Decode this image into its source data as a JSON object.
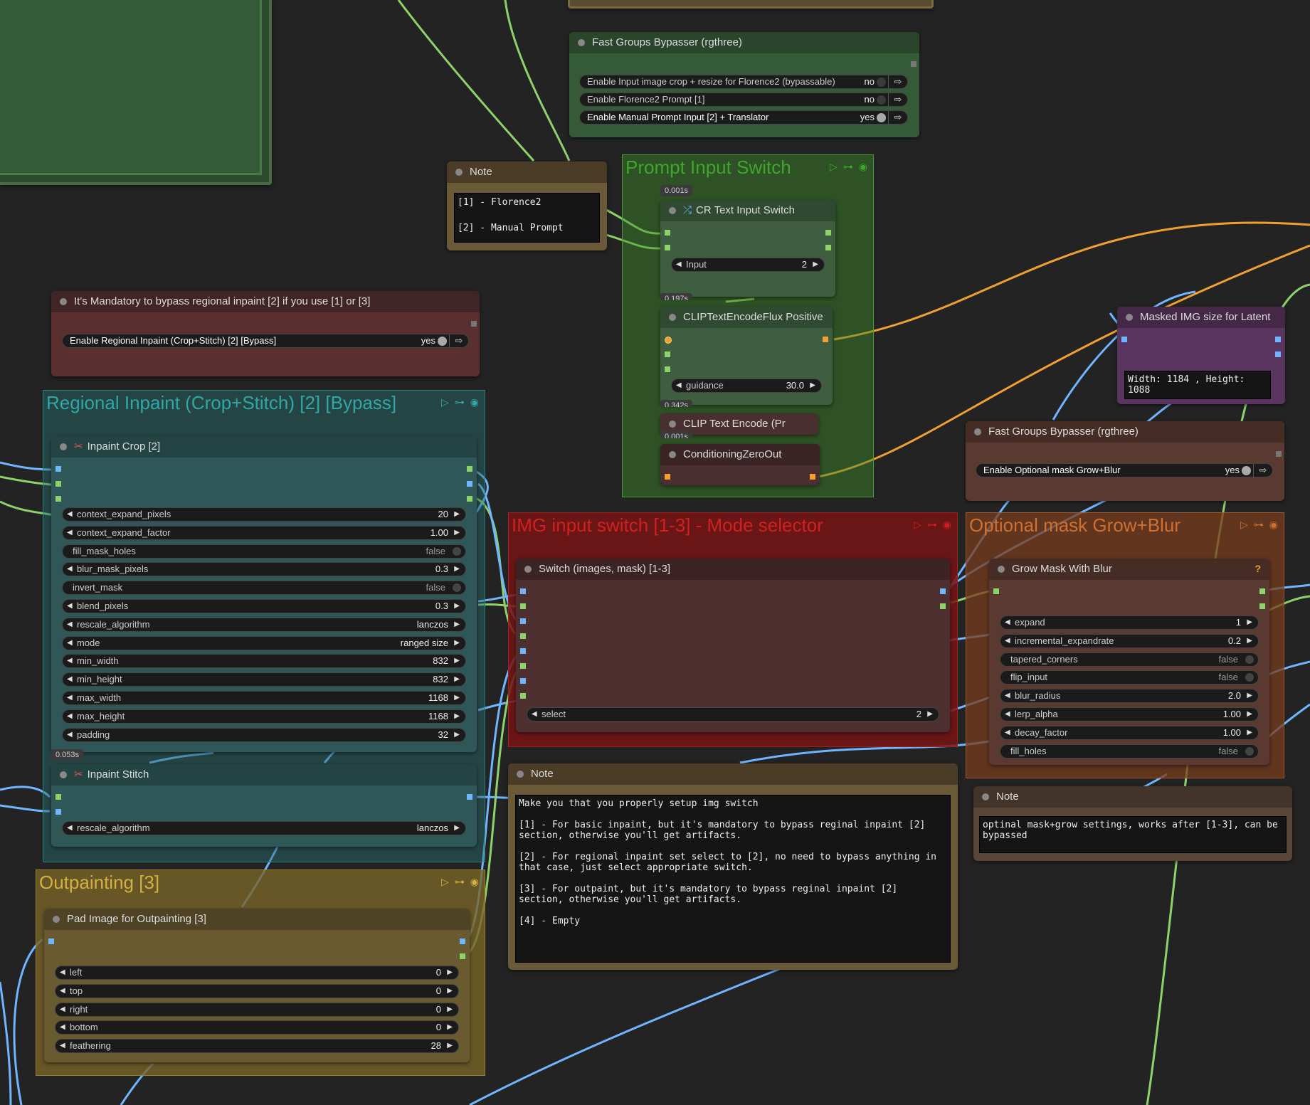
{
  "fgb_top": {
    "title": "Fast Groups Bypasser (rgthree)",
    "rows": [
      {
        "label": "Enable Input image crop + resize for Florence2 (bypassable)",
        "value": "no"
      },
      {
        "label": "Enable Florence2 Prompt [1]",
        "value": "no"
      },
      {
        "label": "Enable Manual Prompt Input [2] + Translator",
        "value": "yes"
      }
    ]
  },
  "note_top": {
    "title": "Note",
    "text": "[1] - Florence2\n\n[2] - Manual Prompt"
  },
  "prompt_group": {
    "title": "Prompt Input Switch"
  },
  "cr_switch": {
    "title": "CR Text Input Switch",
    "timer": "0.001s",
    "widget_label": "Input",
    "widget_value": "2"
  },
  "clip_flux": {
    "title": "CLIPTextEncodeFlux Positive",
    "timer": "0.197s",
    "widget_label": "guidance",
    "widget_value": "30.0"
  },
  "clip_text": {
    "title": "CLIP Text Encode (Pr",
    "timer": "0.342s"
  },
  "cond_zero": {
    "title": "ConditioningZeroOut",
    "timer": "0.001s"
  },
  "fgb_mandatory": {
    "title": "It's Mandatory to bypass regional inpaint [2] if you use [1] or [3]",
    "rows": [
      {
        "label": "Enable Regional Inpaint (Crop+Stitch) [2] [Bypass]",
        "value": "yes"
      }
    ]
  },
  "regional_group": {
    "title": "Regional Inpaint (Crop+Stitch) [2] [Bypass]"
  },
  "inpaint_crop": {
    "title": "Inpaint Crop [2]",
    "widgets": [
      {
        "label": "context_expand_pixels",
        "value": "20",
        "kind": "num"
      },
      {
        "label": "context_expand_factor",
        "value": "1.00",
        "kind": "num"
      },
      {
        "label": "fill_mask_holes",
        "value": "false",
        "kind": "tog"
      },
      {
        "label": "blur_mask_pixels",
        "value": "0.3",
        "kind": "num"
      },
      {
        "label": "invert_mask",
        "value": "false",
        "kind": "tog"
      },
      {
        "label": "blend_pixels",
        "value": "0.3",
        "kind": "num"
      },
      {
        "label": "rescale_algorithm",
        "value": "lanczos",
        "kind": "num"
      },
      {
        "label": "mode",
        "value": "ranged size",
        "kind": "num"
      },
      {
        "label": "min_width",
        "value": "832",
        "kind": "num"
      },
      {
        "label": "min_height",
        "value": "832",
        "kind": "num"
      },
      {
        "label": "max_width",
        "value": "1168",
        "kind": "num"
      },
      {
        "label": "max_height",
        "value": "1168",
        "kind": "num"
      },
      {
        "label": "padding",
        "value": "32",
        "kind": "num"
      }
    ]
  },
  "inpaint_stitch": {
    "title": "Inpaint Stitch",
    "timer": "0.053s",
    "widget_label": "rescale_algorithm",
    "widget_value": "lanczos"
  },
  "outpaint_group": {
    "title": "Outpainting [3]"
  },
  "pad_image": {
    "title": "Pad Image for Outpainting [3]",
    "widgets": [
      {
        "label": "left",
        "value": "0"
      },
      {
        "label": "top",
        "value": "0"
      },
      {
        "label": "right",
        "value": "0"
      },
      {
        "label": "bottom",
        "value": "0"
      },
      {
        "label": "feathering",
        "value": "28"
      }
    ]
  },
  "img_group": {
    "title": "IMG input switch [1-3] - Mode selector"
  },
  "switch_node": {
    "title": "Switch (images, mask) [1-3]",
    "widget_label": "select",
    "widget_value": "2"
  },
  "note_mid": {
    "title": "Note",
    "text": "Make you that you properly setup img switch\n\n[1] - For basic inpaint, but it's mandatory to bypass reginal inpaint [2] section, otherwise you'll get artifacts.\n\n[2] - For regional inpaint set select to [2], no need to bypass anything in that case, just select appropriate switch.\n\n[3] - For outpaint, but it's mandatory to bypass reginal inpaint [2] section, otherwise you'll get artifacts.\n\n[4] - Empty"
  },
  "masked_img": {
    "title": "Masked IMG size for Latent",
    "text": "Width: 1184 , Height:\n1088"
  },
  "fgb_right": {
    "title": "Fast Groups Bypasser (rgthree)",
    "rows": [
      {
        "label": "Enable Optional mask Grow+Blur",
        "value": "yes"
      }
    ]
  },
  "optional_group": {
    "title": "Optional mask Grow+Blur"
  },
  "grow_mask": {
    "title": "Grow Mask With Blur",
    "help": "?",
    "widgets": [
      {
        "label": "expand",
        "value": "1",
        "kind": "num"
      },
      {
        "label": "incremental_expandrate",
        "value": "0.2",
        "kind": "num"
      },
      {
        "label": "tapered_corners",
        "value": "false",
        "kind": "tog"
      },
      {
        "label": "flip_input",
        "value": "false",
        "kind": "tog"
      },
      {
        "label": "blur_radius",
        "value": "2.0",
        "kind": "num"
      },
      {
        "label": "lerp_alpha",
        "value": "1.00",
        "kind": "num"
      },
      {
        "label": "decay_factor",
        "value": "1.00",
        "kind": "num"
      },
      {
        "label": "fill_holes",
        "value": "false",
        "kind": "tog"
      }
    ]
  },
  "note_right": {
    "title": "Note",
    "text": "optinal mask+grow settings, works after [1-3], can be bypassed"
  },
  "colors": {
    "wire_green": "#8ed36a",
    "wire_blue": "#6fb5ff",
    "wire_orange": "#f0a030"
  },
  "icons": {
    "arrow_left": "◀",
    "arrow_right": "▶",
    "go_arrow": "⇨",
    "play": "▷",
    "link": "⊶",
    "eye": "◉",
    "scissors": "✂",
    "shuffle": "⤮"
  }
}
